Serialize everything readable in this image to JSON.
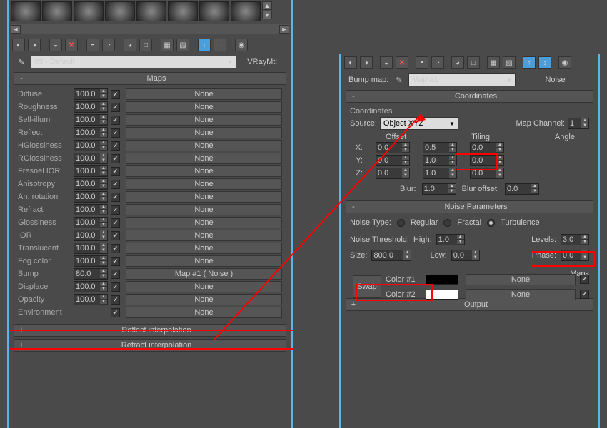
{
  "left": {
    "mat_dropdown": "03 - Default",
    "mat_type": "VRayMtl",
    "maps_title": "Maps",
    "rows": [
      {
        "name": "Diffuse",
        "val": "100.0",
        "chk": true,
        "map": "None"
      },
      {
        "name": "Roughness",
        "val": "100.0",
        "chk": true,
        "map": "None"
      },
      {
        "name": "Self-illum",
        "val": "100.0",
        "chk": true,
        "map": "None"
      },
      {
        "name": "Reflect",
        "val": "100.0",
        "chk": true,
        "map": "None"
      },
      {
        "name": "HGlossiness",
        "val": "100.0",
        "chk": true,
        "map": "None"
      },
      {
        "name": "RGlossiness",
        "val": "100.0",
        "chk": true,
        "map": "None"
      },
      {
        "name": "Fresnel IOR",
        "val": "100.0",
        "chk": true,
        "map": "None"
      },
      {
        "name": "Anisotropy",
        "val": "100.0",
        "chk": true,
        "map": "None"
      },
      {
        "name": "An. rotation",
        "val": "100.0",
        "chk": true,
        "map": "None"
      },
      {
        "name": "Refract",
        "val": "100.0",
        "chk": true,
        "map": "None"
      },
      {
        "name": "Glossiness",
        "val": "100.0",
        "chk": true,
        "map": "None"
      },
      {
        "name": "IOR",
        "val": "100.0",
        "chk": true,
        "map": "None"
      },
      {
        "name": "Translucent",
        "val": "100.0",
        "chk": true,
        "map": "None"
      },
      {
        "name": "Fog color",
        "val": "100.0",
        "chk": true,
        "map": "None"
      },
      {
        "name": "Bump",
        "val": "80.0",
        "chk": true,
        "map": "Map #1  ( Noise )"
      },
      {
        "name": "Displace",
        "val": "100.0",
        "chk": true,
        "map": "None"
      },
      {
        "name": "Opacity",
        "val": "100.0",
        "chk": true,
        "map": "None"
      },
      {
        "name": "Environment",
        "val": "",
        "chk": true,
        "map": "None"
      }
    ],
    "reflect_interp": "Reflect interpolation",
    "refract_interp": "Refract interpolation"
  },
  "right": {
    "bump_label": "Bump map:",
    "map_dropdown": "Map #1",
    "map_type": "Noise",
    "coords_title": "Coordinates",
    "coords_label": "Coordinates",
    "source_label": "Source:",
    "source_val": "Object XYZ",
    "mapch_label": "Map Channel:",
    "mapch_val": "1",
    "offset_hdr": "Offset",
    "tiling_hdr": "Tiling",
    "angle_hdr": "Angle",
    "axes": [
      {
        "a": "X:",
        "off": "0.0",
        "til": "0.5",
        "ang": "0.0"
      },
      {
        "a": "Y:",
        "off": "0.0",
        "til": "1.0",
        "ang": "0.0"
      },
      {
        "a": "Z:",
        "off": "0.0",
        "til": "1.0",
        "ang": "0.0"
      }
    ],
    "blur_label": "Blur:",
    "blur_val": "1.0",
    "bluroff_label": "Blur offset:",
    "bluroff_val": "0.0",
    "noise_title": "Noise Parameters",
    "noise_type_label": "Noise Type:",
    "nt_regular": "Regular",
    "nt_fractal": "Fractal",
    "nt_turb": "Turbulence",
    "thresh_label": "Noise Threshold:",
    "high_label": "High:",
    "high_val": "1.0",
    "levels_label": "Levels:",
    "levels_val": "3.0",
    "size_label": "Size:",
    "size_val": "800.0",
    "low_label": "Low:",
    "low_val": "0.0",
    "phase_label": "Phase:",
    "phase_val": "0.0",
    "color1": "#000000",
    "color2": "#ffffff",
    "swap": "Swap",
    "color1_label": "Color #1",
    "color2_label": "Color #2",
    "mapslbl": "Maps",
    "none": "None",
    "output_title": "Output"
  }
}
